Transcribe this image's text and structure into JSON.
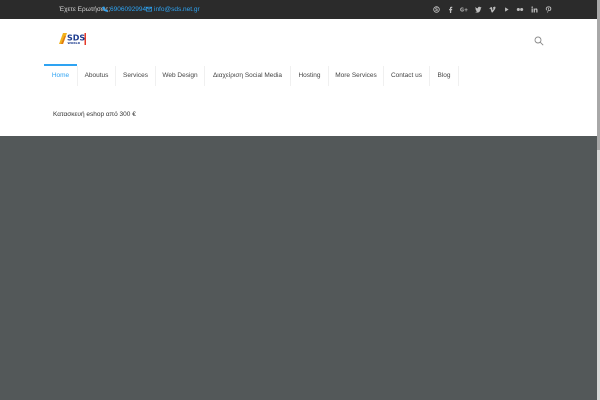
{
  "topbar": {
    "question": "Έχετε Ερωτήσεις;",
    "phone": "6906092994",
    "email": "info@sds.net.gr",
    "social_icons": [
      "skype-icon",
      "facebook-icon",
      "google-plus-icon",
      "twitter-icon",
      "vimeo-icon",
      "youtube-icon",
      "flickr-icon",
      "linkedin-icon",
      "pinterest-icon"
    ]
  },
  "header": {
    "logo_text": "SDS",
    "logo_subtext": "WORLD"
  },
  "nav": {
    "items": [
      {
        "label": "Home",
        "active": true
      },
      {
        "label": "Aboutus"
      },
      {
        "label": "Services"
      },
      {
        "label": "Web Design"
      },
      {
        "label": "Διαχείριση Social Media"
      },
      {
        "label": "Hosting"
      },
      {
        "label": "More Services"
      },
      {
        "label": "Contact us"
      },
      {
        "label": "Blog"
      }
    ]
  },
  "promo": {
    "text": "Κατασκευή eshop από 300 €"
  },
  "colors": {
    "accent": "#2ea3f2",
    "topbar_bg": "#2b2b2b",
    "hero_bg": "#535859"
  }
}
